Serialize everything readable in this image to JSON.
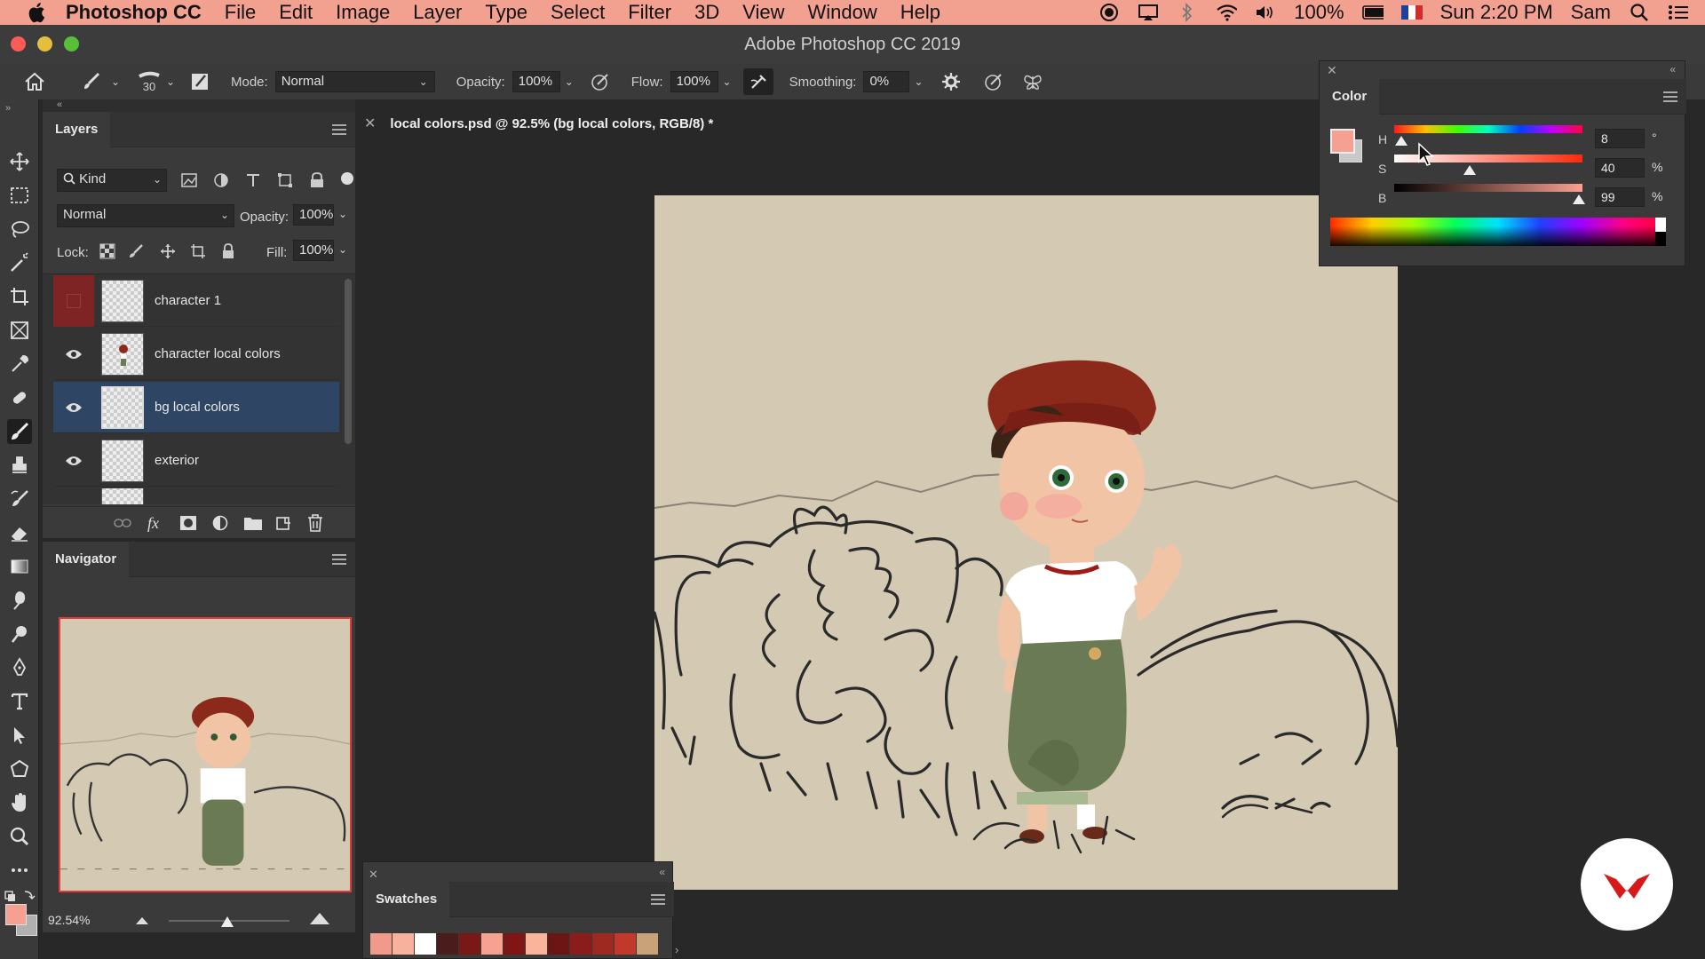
{
  "menubar": {
    "app_name": "Photoshop CC",
    "items": [
      "File",
      "Edit",
      "Image",
      "Layer",
      "Type",
      "Select",
      "Filter",
      "3D",
      "View",
      "Window",
      "Help"
    ],
    "battery": "100%",
    "clock": "Sun 2:20 PM",
    "user": "Sam"
  },
  "window": {
    "title": "Adobe Photoshop CC 2019"
  },
  "options": {
    "brush_size": "30",
    "mode_label": "Mode:",
    "mode_value": "Normal",
    "opacity_label": "Opacity:",
    "opacity_value": "100%",
    "flow_label": "Flow:",
    "flow_value": "100%",
    "smoothing_label": "Smoothing:",
    "smoothing_value": "0%"
  },
  "layers_panel": {
    "tab": "Layers",
    "filter": "Kind",
    "blend": "Normal",
    "opacity_label": "Opacity:",
    "opacity_value": "100%",
    "lock_label": "Lock:",
    "fill_label": "Fill:",
    "fill_value": "100%",
    "layers": [
      {
        "name": "character 1",
        "visible": false,
        "selected": false
      },
      {
        "name": "character local colors",
        "visible": true,
        "selected": false
      },
      {
        "name": "bg local colors",
        "visible": true,
        "selected": true
      },
      {
        "name": "exterior",
        "visible": true,
        "selected": false
      }
    ]
  },
  "navigator": {
    "tab": "Navigator",
    "zoom": "92.54%"
  },
  "document": {
    "tab_title": "local colors.psd @ 92.5% (bg local colors, RGB/8) *"
  },
  "color_panel": {
    "tab": "Color",
    "h_label": "H",
    "h_value": "8",
    "h_unit": "°",
    "s_label": "S",
    "s_value": "40",
    "s_unit": "%",
    "b_label": "B",
    "b_value": "99",
    "b_unit": "%",
    "foreground": "#f6a091",
    "background": "#c8c8c8"
  },
  "swatches": {
    "tab": "Swatches",
    "colors": [
      "#f19a8c",
      "#f6b29c",
      "#ffffff",
      "#4a1c1c",
      "#7a1818",
      "#f7a290",
      "#7f1515",
      "#f9b49b",
      "#6b1515",
      "#8a1c1c",
      "#9c2a20",
      "#c0392b",
      "#c9a27a"
    ]
  }
}
